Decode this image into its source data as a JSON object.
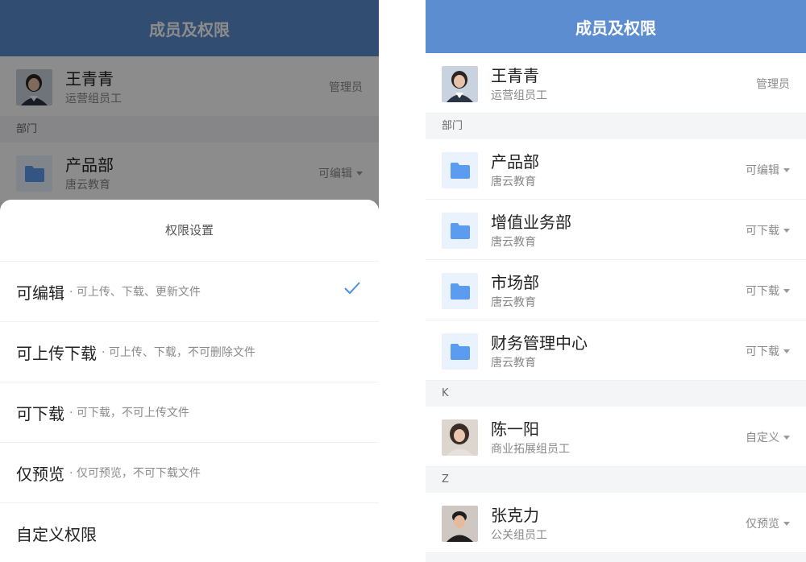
{
  "left": {
    "header": {
      "title": "成员及权限"
    },
    "admin": {
      "name": "王青青",
      "role": "运营组员工",
      "permission": "管理员"
    },
    "section_department": "部门",
    "dept": {
      "name": "产品部",
      "org": "唐云教育",
      "permission": "可编辑"
    },
    "sheet": {
      "title": "权限设置",
      "options": [
        {
          "name": "可编辑",
          "desc": "· 可上传、下载、更新文件",
          "selected": true
        },
        {
          "name": "可上传下载",
          "desc": "· 可上传、下载，不可删除文件",
          "selected": false
        },
        {
          "name": "可下载",
          "desc": "· 可下载，不可上传文件",
          "selected": false
        },
        {
          "name": "仅预览",
          "desc": "· 仅可预览，不可下载文件",
          "selected": false
        },
        {
          "name": "自定义权限",
          "desc": "",
          "selected": false
        }
      ]
    }
  },
  "right": {
    "header": {
      "title": "成员及权限"
    },
    "admin": {
      "name": "王青青",
      "role": "运营组员工",
      "permission": "管理员"
    },
    "section_department": "部门",
    "departments": [
      {
        "name": "产品部",
        "org": "唐云教育",
        "permission": "可编辑"
      },
      {
        "name": "增值业务部",
        "org": "唐云教育",
        "permission": "可下载"
      },
      {
        "name": "市场部",
        "org": "唐云教育",
        "permission": "可下载"
      },
      {
        "name": "财务管理中心",
        "org": "唐云教育",
        "permission": "可下载"
      }
    ],
    "section_k": "K",
    "member_k": {
      "name": "陈一阳",
      "role": "商业拓展组员工",
      "permission": "自定义"
    },
    "section_z": "Z",
    "member_z": {
      "name": "张克力",
      "role": "公关组员工",
      "permission": "仅预览"
    }
  },
  "colors": {
    "accent": "#5b8dd0",
    "folder": "#5b9bf0",
    "folder_bg": "#eaf2fd",
    "check": "#4a90e2"
  },
  "icons": {
    "folder": "folder-icon",
    "check": "checkmark-icon",
    "caret": "caret-down-icon"
  }
}
